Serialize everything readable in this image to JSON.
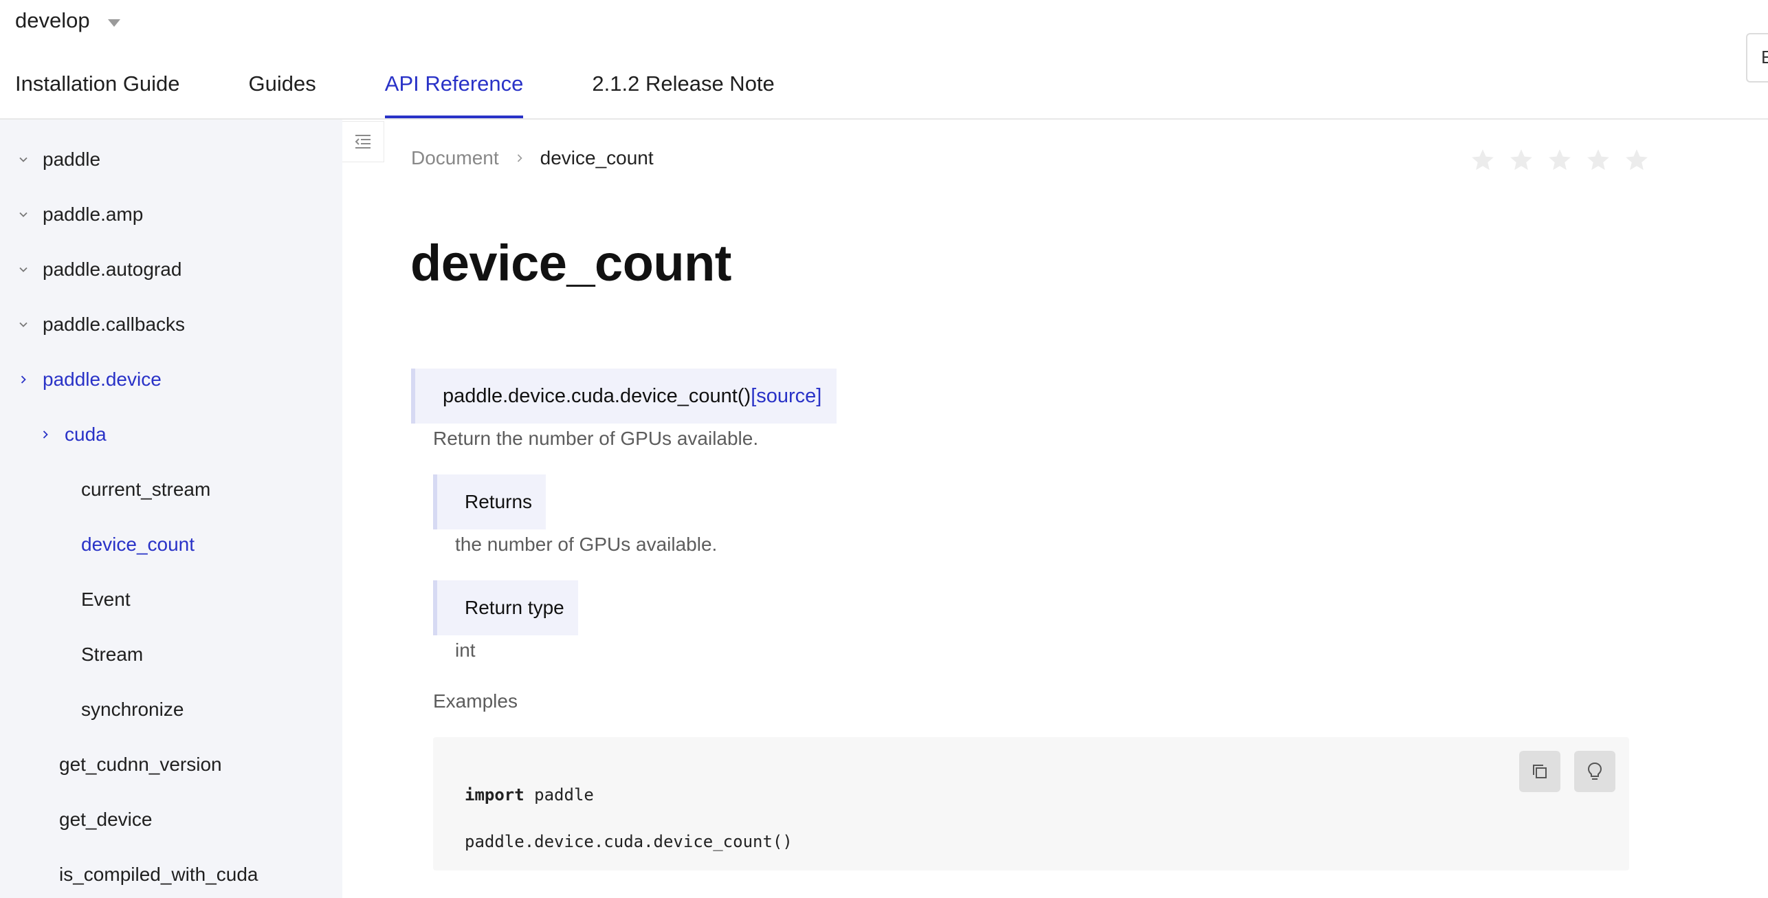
{
  "header": {
    "version": "develop",
    "tabs": [
      {
        "label": "Installation Guide"
      },
      {
        "label": "Guides"
      },
      {
        "label": "API Reference"
      },
      {
        "label": "2.1.2 Release Note"
      }
    ],
    "corner_text": "E"
  },
  "sidebar": {
    "items": [
      {
        "label": "paddle"
      },
      {
        "label": "paddle.amp"
      },
      {
        "label": "paddle.autograd"
      },
      {
        "label": "paddle.callbacks"
      },
      {
        "label": "paddle.device"
      },
      {
        "label": "cuda"
      },
      {
        "label": "current_stream"
      },
      {
        "label": "device_count"
      },
      {
        "label": "Event"
      },
      {
        "label": "Stream"
      },
      {
        "label": "synchronize"
      },
      {
        "label": "get_cudnn_version"
      },
      {
        "label": "get_device"
      },
      {
        "label": "is_compiled_with_cuda"
      }
    ]
  },
  "breadcrumb": {
    "root": "Document",
    "current": "device_count"
  },
  "rating": {
    "max": 5,
    "value": 0
  },
  "doc": {
    "title": "device_count",
    "signature": "paddle.device.cuda.device_count()",
    "source_link": "[source]",
    "description": "Return the number of GPUs available.",
    "returns_label": "Returns",
    "returns_text": "the number of GPUs available.",
    "return_type_label": "Return type",
    "return_type_text": "int",
    "examples_label": "Examples",
    "code_keyword": "import",
    "code_line1_rest": " paddle",
    "code_line2": "paddle.device.cuda.device_count()"
  },
  "colors": {
    "accent": "#2932c7",
    "sidebar_bg": "#f4f5f9",
    "field_bg": "#f1f2fb"
  }
}
